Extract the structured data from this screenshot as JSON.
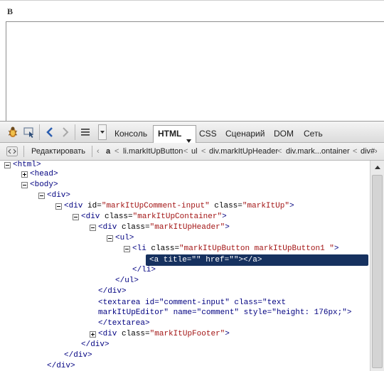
{
  "editor": {
    "bold_button": "B"
  },
  "toolbar": {
    "icons": [
      "firebug-icon",
      "inspect-icon",
      "back-icon",
      "forward-icon",
      "panel-menu-icon",
      "dropdown-arrow-icon"
    ],
    "tabs": [
      {
        "label": "Консоль"
      },
      {
        "label": "HTML"
      },
      {
        "label": "CSS"
      },
      {
        "label": "Сценарий"
      },
      {
        "label": "DOM"
      },
      {
        "label": "Сеть"
      }
    ],
    "active_tab": "HTML"
  },
  "breadcrumb": {
    "edit_label": "Редактировать",
    "items": [
      "a",
      "li.markItUpButton",
      "ul",
      "div.markItUpHeader",
      "div.mark...ontainer",
      "div#"
    ]
  },
  "tree": {
    "rows": [
      {
        "text": "<html>",
        "open": true
      },
      {
        "text": "<head>",
        "open": false
      },
      {
        "text": "<body>",
        "open": true
      },
      {
        "text": "<div>",
        "open": true
      },
      {
        "tag": "<div",
        "attrs": [
          [
            "id",
            "markItUpComment-input"
          ],
          [
            "class",
            "markItUp"
          ]
        ],
        "close": ">",
        "open": true
      },
      {
        "tag": "<div",
        "attrs": [
          [
            "class",
            "markItUpContainer"
          ]
        ],
        "close": ">",
        "open": true
      },
      {
        "tag": "<div",
        "attrs": [
          [
            "class",
            "markItUpHeader"
          ]
        ],
        "close": ">",
        "open": true
      },
      {
        "text": "<ul>",
        "open": true
      },
      {
        "tag": "<li",
        "attrs": [
          [
            "class",
            "markItUpButton markItUpButton1 "
          ]
        ],
        "close": ">",
        "open": true
      },
      {
        "selected": "<a title=\"\" href=\"\"></a>"
      },
      {
        "text": "</li>"
      },
      {
        "text": "</ul>"
      },
      {
        "text": "</div>"
      },
      {
        "line1": "<textarea id=\"comment-input\" class=\"text",
        "line2": "markItUpEditor\" name=\"comment\" style=\"height: 176px;\">"
      },
      {
        "text": "</textarea>"
      },
      {
        "tag": "<div",
        "attrs": [
          [
            "class",
            "markItUpFooter"
          ]
        ],
        "close": ">",
        "open": false
      },
      {
        "text": "</div>"
      },
      {
        "text": "</div>"
      },
      {
        "text": "</div>"
      }
    ]
  },
  "colors": {
    "selection_bg": "#16315f",
    "tag": "#000080",
    "value": "#a31515"
  }
}
